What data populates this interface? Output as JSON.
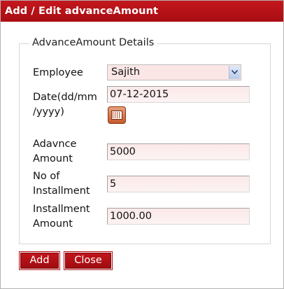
{
  "window": {
    "title": "Add / Edit advanceAmount"
  },
  "form": {
    "legend": "AdvanceAmount Details",
    "employee": {
      "label": "Employee",
      "value": "Sajith"
    },
    "date": {
      "label_line1": "Date(dd/mm",
      "label_line2": "/yyyy)",
      "value": "07-12-2015",
      "picker_icon": "calendar-icon"
    },
    "advance_amount": {
      "label_line1": "Adavnce",
      "label_line2": "Amount",
      "value": "5000"
    },
    "installments": {
      "label_line1": "No of",
      "label_line2": "Installment",
      "value": "5"
    },
    "installment_amount": {
      "label_line1": "Installment",
      "label_line2": "Amount",
      "value": "1000.00"
    }
  },
  "buttons": {
    "add": "Add",
    "close": "Close"
  },
  "colors": {
    "title_bar": "#b51218",
    "button": "#b51218",
    "input_background": "#fbe8e8"
  }
}
